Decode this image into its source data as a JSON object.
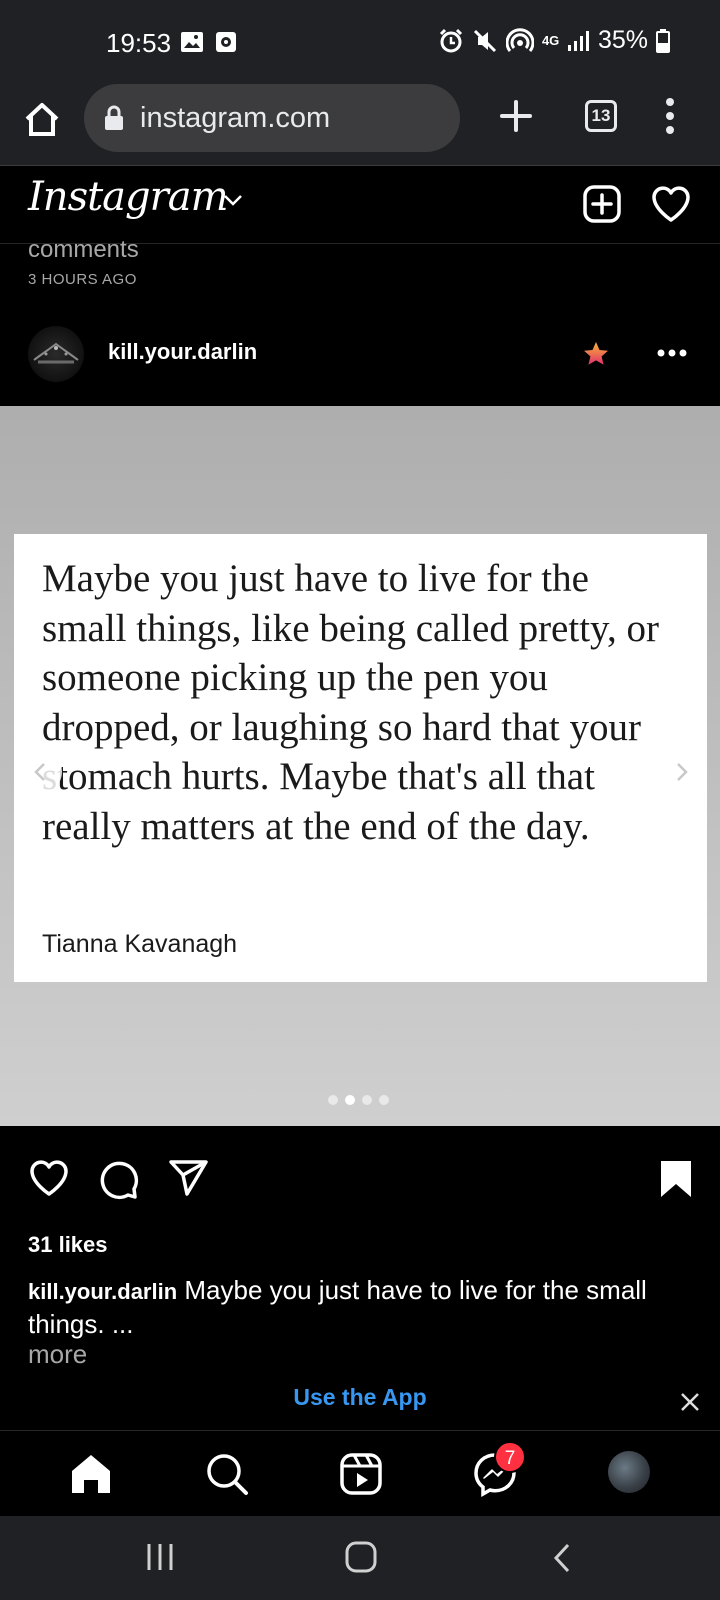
{
  "status_bar": {
    "time": "19:53",
    "network": "4G",
    "battery": "35%",
    "icons": [
      "gallery-icon",
      "screen-record-icon",
      "alarm-icon",
      "mute-icon",
      "hotspot-icon",
      "signal-icon",
      "battery-icon"
    ]
  },
  "browser": {
    "url": "instagram.com",
    "tab_count": "13"
  },
  "ig_header": {
    "logo": "Instagram"
  },
  "previous_post": {
    "comments_text": "comments",
    "time_ago": "3 HOURS AGO"
  },
  "post": {
    "username": "kill.your.darlin",
    "quote": "Maybe you just have to live for the small things, like being called pretty, or someone picking up the pen you dropped, or laughing so hard that your stomach hurts. Maybe that's all that really matters at the end of the day.",
    "quote_author": "Tianna Kavanagh",
    "carousel": {
      "total": 4,
      "active_index": 1
    },
    "likes": "31 likes",
    "caption_user": "kill.your.darlin",
    "caption_text": "Maybe you just have to live for the small things. ...",
    "more": "more"
  },
  "banner": {
    "label": "Use the App"
  },
  "bottom_nav": {
    "messages_badge": "7"
  },
  "colors": {
    "accent": "#3897f0",
    "badge": "#ff3040",
    "chrome_bg": "#202124"
  }
}
